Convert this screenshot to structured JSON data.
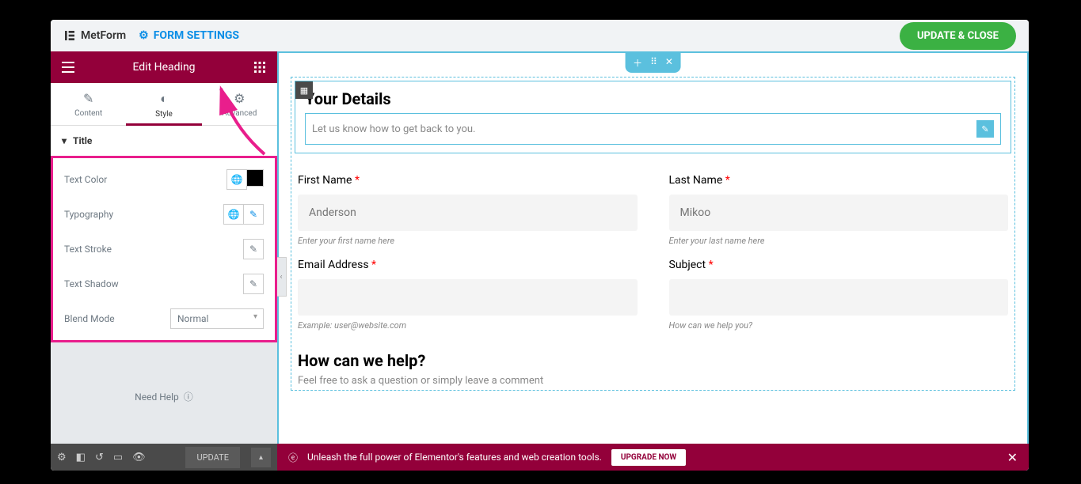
{
  "header": {
    "brand": "MetForm",
    "form_settings": "FORM SETTINGS",
    "update_close": "UPDATE & CLOSE"
  },
  "sidebar": {
    "title": "Edit Heading",
    "tabs": {
      "content": "Content",
      "style": "Style",
      "advanced": "Advanced"
    },
    "accordion": "Title",
    "rows": {
      "text_color": "Text Color",
      "typography": "Typography",
      "text_stroke": "Text Stroke",
      "text_shadow": "Text Shadow",
      "blend_mode": "Blend Mode",
      "blend_value": "Normal"
    },
    "need_help": "Need Help",
    "footer": {
      "update": "UPDATE"
    }
  },
  "canvas": {
    "heading": "Your Details",
    "subheading": "Let us know how to get back to you.",
    "fields": {
      "first_name": {
        "label": "First Name",
        "placeholder": "Anderson",
        "helper": "Enter your first name here"
      },
      "last_name": {
        "label": "Last Name",
        "placeholder": "Mikoo",
        "helper": "Enter your last name here"
      },
      "email": {
        "label": "Email Address",
        "helper": "Example: user@website.com"
      },
      "subject": {
        "label": "Subject",
        "helper": "How can we help you?"
      }
    },
    "section2": {
      "title": "How can we help?",
      "sub": "Feel free to ask a question or simply leave a comment"
    }
  },
  "bottombar": {
    "text": "Unleash the full power of Elementor's features and web creation tools.",
    "upgrade": "UPGRADE NOW"
  }
}
